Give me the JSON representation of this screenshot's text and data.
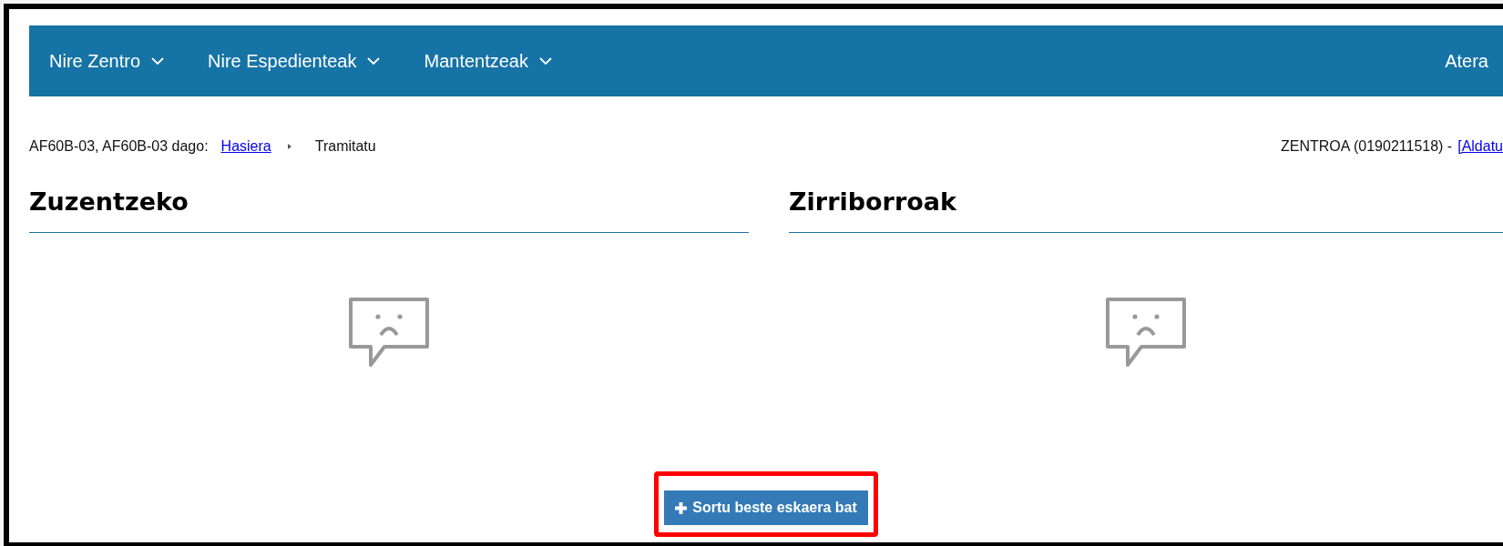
{
  "nav": {
    "menus": [
      {
        "label": "Nire Zentro",
        "has_dropdown": true
      },
      {
        "label": "Nire Espedienteak",
        "has_dropdown": true
      },
      {
        "label": "Mantentzeak",
        "has_dropdown": true
      }
    ],
    "logout": "Atera"
  },
  "breadcrumb": {
    "prefix": "AF60B-03, AF60B-03 dago:",
    "items": [
      {
        "label": "Hasiera",
        "link": true
      },
      {
        "label": "Tramitatu",
        "link": false
      }
    ]
  },
  "center": {
    "text": "ZENTROA (0190211518) -",
    "link": "[Aldatu"
  },
  "panels": [
    {
      "title": "Zuzentzeko",
      "empty": true
    },
    {
      "title": "Zirriborroak",
      "empty": true
    }
  ],
  "action_button": {
    "label": "Sortu beste eskaera bat",
    "highlighted": true
  }
}
